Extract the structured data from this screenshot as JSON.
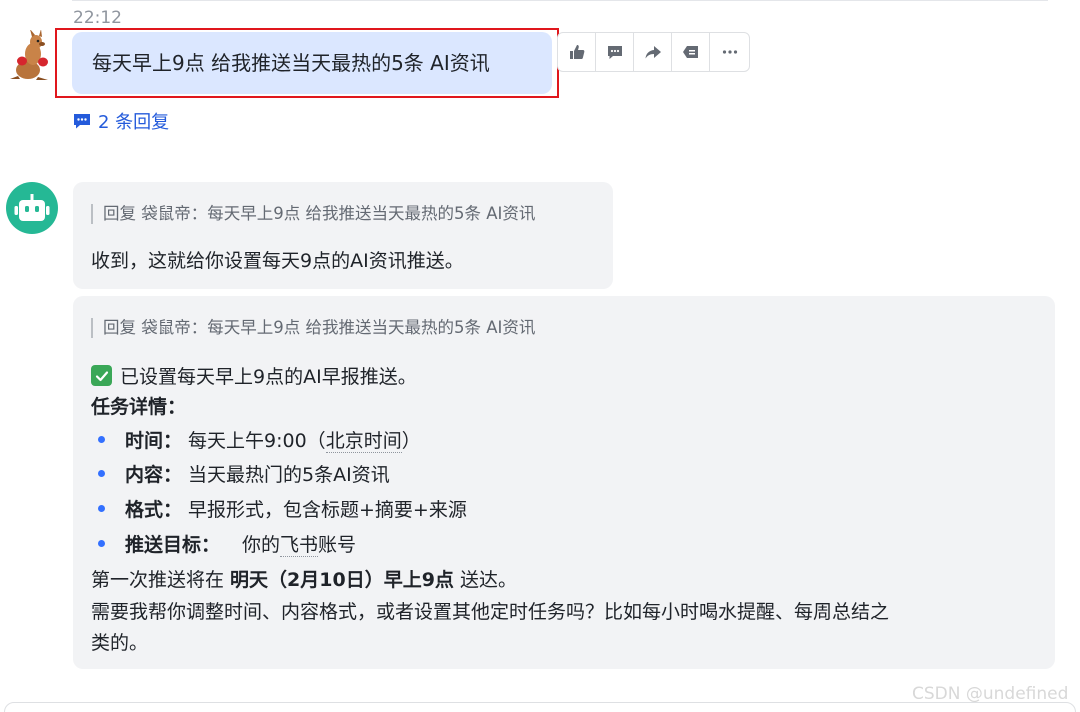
{
  "timestamp": "22:12",
  "user_message": {
    "text": "每天早上9点 给我推送当天最热的5条 AI资讯",
    "highlight_color": "#e0171d"
  },
  "toolbar": {
    "icons": [
      "thumbs-up-icon",
      "comment-icon",
      "forward-icon",
      "reply-icon",
      "more-icon"
    ]
  },
  "thread": {
    "reply_count_label": "2 条回复"
  },
  "bot_reply_1": {
    "quote": "回复 袋鼠帝：每天早上9点 给我推送当天最热的5条 AI资讯",
    "text": "收到，这就给你设置每天9点的AI资讯推送。"
  },
  "bot_reply_2": {
    "quote": "回复 袋鼠帝：每天早上9点 给我推送当天最热的5条 AI资讯",
    "confirm": "已设置每天早上9点的AI早报推送。",
    "details_title": "任务详情：",
    "details": [
      {
        "key": "时间：",
        "value_prefix": "每天上午9:00（",
        "value_link": "北京时间",
        "value_suffix": "）"
      },
      {
        "key": "内容：",
        "value": "当天最热门的5条AI资讯"
      },
      {
        "key": "格式：",
        "value": "早报形式，包含标题+摘要+来源"
      },
      {
        "key": "推送目标：",
        "value_prefix": "你的",
        "value_link": "飞书",
        "value_suffix": "账号"
      }
    ],
    "first_push_prefix": "第一次推送将在 ",
    "first_push_bold": "明天（2月10日）早上9点",
    "first_push_suffix": " 送达。",
    "question_line1": "需要我帮你调整时间、内容格式，或者设置其他定时任务吗？比如每小时喝水提醒、每周总结之",
    "question_line2": "类的。"
  },
  "watermark": "CSDN @undefined",
  "colors": {
    "user_bubble": "#dbe7ff",
    "bot_bubble": "#f2f3f5",
    "link_blue": "#245bdb",
    "bot_avatar": "#25b895",
    "check_green": "#3aa757"
  }
}
